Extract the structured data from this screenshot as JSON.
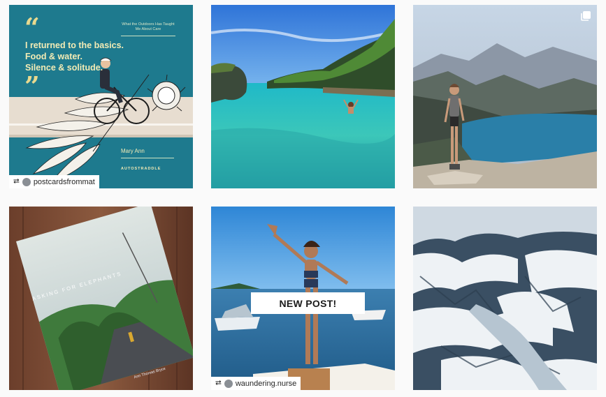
{
  "grid": {
    "posts": [
      {
        "kind": "graphic-quote",
        "quote_lines": [
          "I returned to the basics.",
          "Food & water.",
          "Silence & solitude."
        ],
        "side_heading": "What the Outdoors Has Taught Me About Care",
        "author": "Mary Ann",
        "brand": "AUTOSTRADDLE",
        "repost_user": "postcardsfrommat"
      },
      {
        "kind": "photo",
        "subject": "tropical lagoon swimmer"
      },
      {
        "kind": "photo",
        "subject": "hiker on mountain ridge above lake",
        "overlay_icon": "multiple-photos-icon"
      },
      {
        "kind": "photo",
        "subject": "book cover on wooden table",
        "book_title": "ASKING FOR ELEPHANTS",
        "book_author": "Ann Thomas Bryce"
      },
      {
        "kind": "photo",
        "subject": "woman on boat waving",
        "banner": "NEW POST!",
        "repost_user": "waundering.nurse"
      },
      {
        "kind": "photo",
        "subject": "aerial glacier mountains"
      }
    ]
  },
  "colors": {
    "graphic_bg": "#1e7a8e",
    "graphic_text": "#f2ebb5",
    "page_bg": "#fafafa"
  }
}
